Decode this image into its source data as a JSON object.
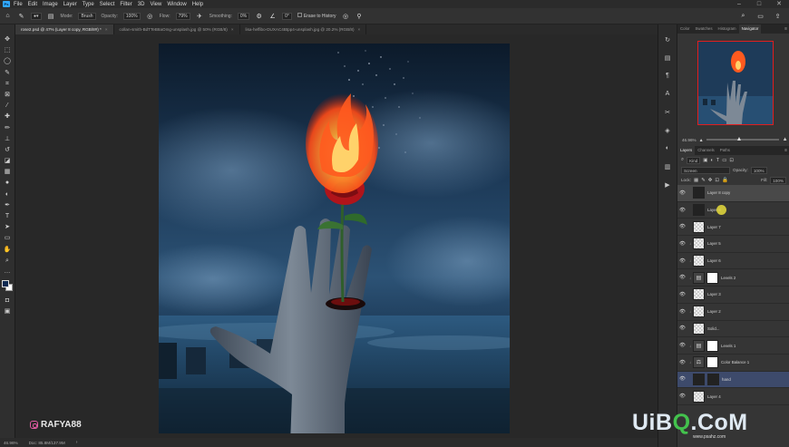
{
  "menubar": {
    "logo": "Ps",
    "items": [
      "File",
      "Edit",
      "Image",
      "Layer",
      "Type",
      "Select",
      "Filter",
      "3D",
      "View",
      "Window",
      "Help"
    ],
    "window_controls": [
      "–",
      "□",
      "✕"
    ]
  },
  "options_bar": {
    "mode_label": "Mode:",
    "mode_value": "Brush",
    "opacity_label": "Opacity:",
    "opacity_value": "100%",
    "flow_label": "Flow:",
    "flow_value": "79%",
    "smoothing_label": "Smoothing:",
    "smoothing_value": "0%",
    "angle_value": "0°",
    "erase_history_label": "Erase to History"
  },
  "tabs": [
    {
      "label": "rose2.psd @ 47% (Layer 8 copy, RGB/8#) *",
      "active": true
    },
    {
      "label": "collan-smith-BdTTeB8aOmg-unsplash.jpg @ 50% (RGB/8)",
      "active": false
    },
    {
      "label": "lisa-heffibo-DUXAC4Btpp4-unsplash.jpg @ 20.2% (RGB/8)",
      "active": false
    }
  ],
  "tools": [
    "move-icon",
    "artboard-icon",
    "lasso-icon",
    "quick-select-icon",
    "crop-icon",
    "frame-icon",
    "eyedropper-icon",
    "healing-icon",
    "brush-icon",
    "stamp-icon",
    "history-brush-icon",
    "eraser-icon",
    "gradient-icon",
    "blur-icon",
    "dodge-icon",
    "pen-icon",
    "type-icon",
    "path-select-icon",
    "rectangle-icon",
    "hand-icon",
    "zoom-icon",
    "more-icon"
  ],
  "watermark_text": "RAFYA88",
  "status": {
    "zoom": "46.96%",
    "doc": "Doc: 85.8M/137.9M"
  },
  "right_panel": {
    "top_tabs": [
      "Color",
      "Swatches",
      "Histogram",
      "Navigator"
    ],
    "active_top_tab": "Navigator",
    "nav_zoom": "46.96%",
    "layer_tabs": [
      "Layers",
      "Channels",
      "Paths"
    ],
    "active_layer_tab": "Layers",
    "filter_kind": "Kind",
    "blend_mode": "Screen",
    "opacity_label": "Opacity:",
    "opacity_value": "100%",
    "lock_label": "Lock:",
    "fill_label": "Fill:",
    "fill_value": "100%",
    "layers": [
      {
        "name": "Layer 8 copy",
        "thumb": "art",
        "selected": true
      },
      {
        "name": "Layer 8",
        "thumb": "art",
        "selected": false
      },
      {
        "name": "Layer 7",
        "thumb": "check",
        "selected": false
      },
      {
        "name": "Layer 5",
        "thumb": "check",
        "selected": false
      },
      {
        "name": "Layer 6",
        "thumb": "check",
        "selected": false
      },
      {
        "name": "Levels 2",
        "thumb": "adj",
        "selected": false
      },
      {
        "name": "Layer 3",
        "thumb": "check",
        "selected": false
      },
      {
        "name": "Layer 2",
        "thumb": "check",
        "selected": false
      },
      {
        "name": "Solid...",
        "thumb": "check",
        "selected": false
      },
      {
        "name": "Levels 1",
        "thumb": "adj",
        "selected": false
      },
      {
        "name": "Color Balance 1",
        "thumb": "adj",
        "selected": false
      },
      {
        "name": "hand",
        "thumb": "dark",
        "selected": false,
        "blue": true
      },
      {
        "name": "Layer 4",
        "thumb": "check",
        "selected": false
      }
    ]
  },
  "site_watermark": {
    "main_prefix": "UiB",
    "main_green": "Q",
    "main_suffix": ".CoM",
    "sub": "www.psahz.com"
  },
  "colors": {
    "ps_blue": "#31a8ff",
    "sky_dark": "#0f2236",
    "sky_mid": "#2a4d6e",
    "flame": "#ff5a1f",
    "rose": "#c0141c",
    "accent_red": "#e01e1e"
  }
}
